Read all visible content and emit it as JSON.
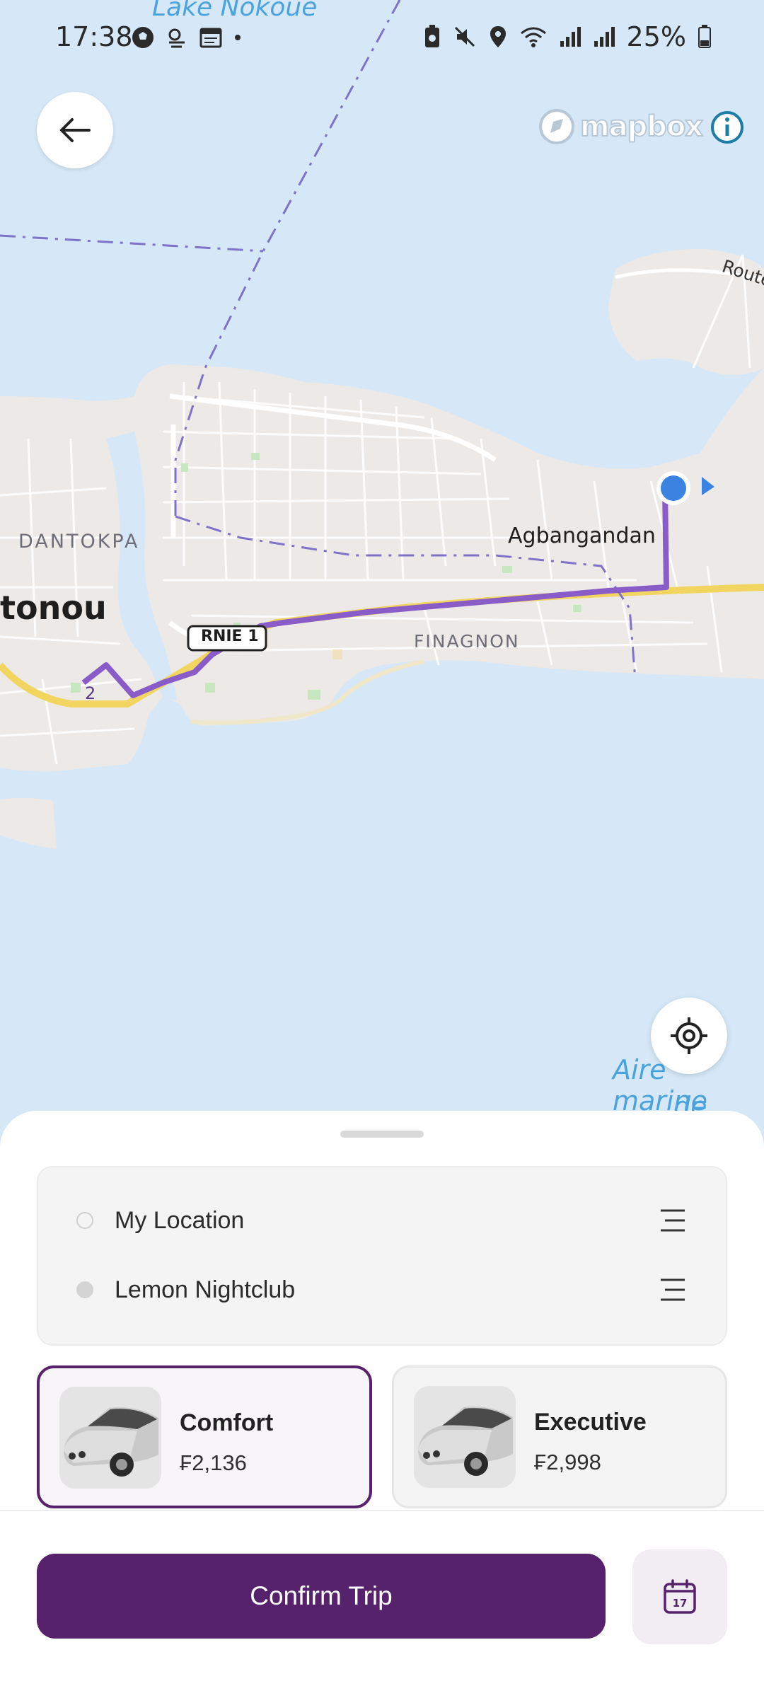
{
  "status_bar": {
    "time": "17:38",
    "battery": "25%",
    "left_icons": [
      "soccer-ball-icon",
      "weather-icon",
      "calendar-icon",
      "dot-icon"
    ],
    "right_icons": [
      "battery-saver-icon",
      "mute-icon",
      "location-icon",
      "wifi-icon",
      "signal-icon",
      "signal-icon",
      "battery-icon"
    ]
  },
  "map": {
    "attribution": "mapbox",
    "labels": {
      "lake": "Lake Nokoué",
      "dantokpa": "DANTOKPA",
      "city": "tonou",
      "agbangandan": "Agbangandan",
      "finagnon": "FINAGNON",
      "road_shield": "RNIE 1",
      "route": "Route",
      "marine_1": "Aire marine",
      "marine_2": "de Donat",
      "waypoint": "2"
    },
    "colors": {
      "water": "#d6e8f7",
      "land": "#ece9e7",
      "route": "#8a5cc7",
      "highway": "#f2d560",
      "boundary": "#7e72c9",
      "location_dot": "#3b83e0"
    }
  },
  "trip": {
    "origin": "My Location",
    "destination": "Lemon Nightclub"
  },
  "ride_options": [
    {
      "name": "Comfort",
      "price": "₣2,136",
      "selected": true
    },
    {
      "name": "Executive",
      "price": "₣2,998",
      "selected": false
    }
  ],
  "actions": {
    "confirm_label": "Confirm Trip",
    "schedule_day": "17"
  },
  "theme": {
    "primary": "#56226b",
    "selected_card_bg": "#f8f5f8"
  }
}
